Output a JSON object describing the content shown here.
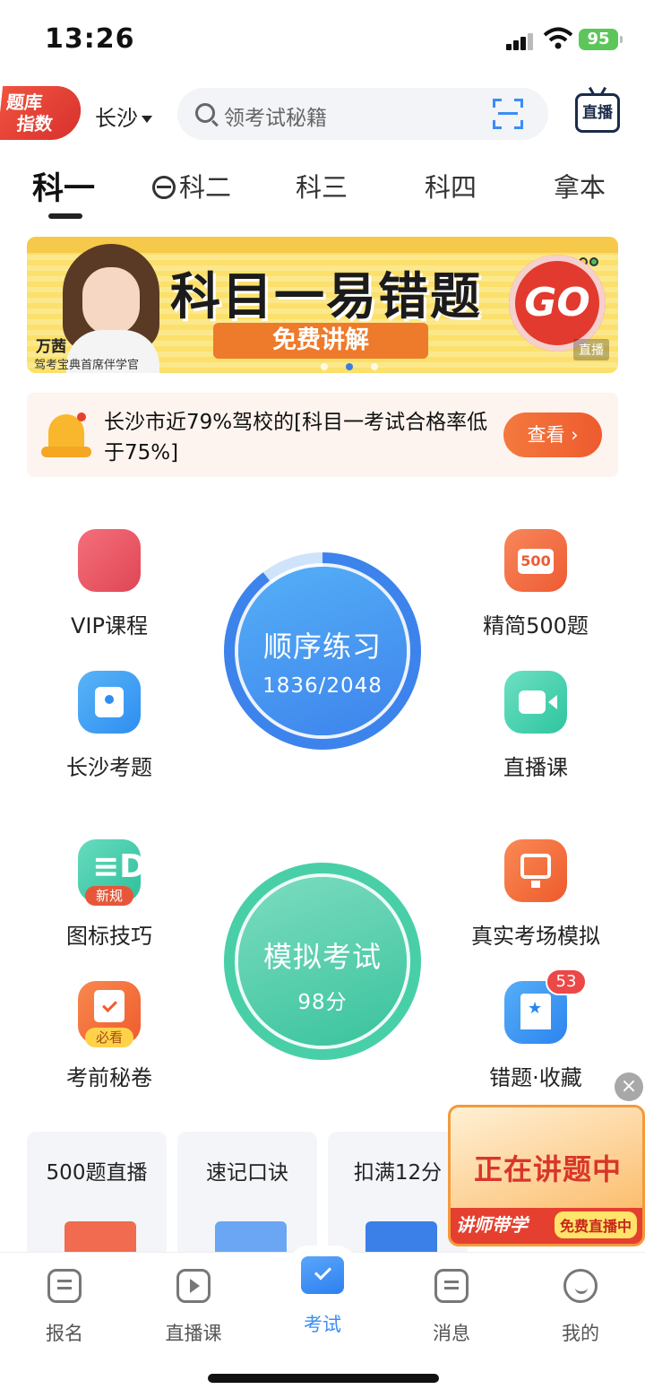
{
  "status": {
    "time": "13:26",
    "battery": "95"
  },
  "header": {
    "logo_line1": "题库",
    "logo_line2": "指数",
    "city": "长沙",
    "search_placeholder": "领考试秘籍",
    "live_label": "直播"
  },
  "tabs": [
    {
      "label": "科一",
      "active": true
    },
    {
      "label": "科二",
      "icon": "steering-wheel-icon"
    },
    {
      "label": "科三"
    },
    {
      "label": "科四"
    },
    {
      "label": "拿本"
    }
  ],
  "banner": {
    "title": "科目一易错题",
    "subtitle": "免费讲解",
    "host_name": "万茜",
    "host_title": "驾考宝典首席伴学官",
    "go": "GO",
    "live_tag": "直播"
  },
  "notice": {
    "text": "长沙市近79%驾校的[科目一考试合格率低于75%]",
    "button": "查看 ›"
  },
  "features": {
    "vip": "VIP课程",
    "simple500": "精简500题",
    "simple500_badge": "500",
    "local": "长沙考题",
    "live_course": "直播课",
    "icon_tips": "图标技巧",
    "icon_tips_badge": "新规",
    "real_exam": "真实考场模拟",
    "secret": "考前秘卷",
    "secret_badge": "必看",
    "wrong_fav": "错题·收藏",
    "wrong_fav_count": "53"
  },
  "practice": {
    "title": "顺序练习",
    "progress": "1836/2048",
    "done": 1836,
    "total": 2048
  },
  "mock": {
    "title": "模拟考试",
    "score": "98分"
  },
  "cards": [
    {
      "title": "500题直播"
    },
    {
      "title": "速记口诀"
    },
    {
      "title": "扣满12分"
    }
  ],
  "promo": {
    "main": "正在讲题中",
    "left": "讲师带学",
    "right": "免费直播中",
    "close": "×"
  },
  "tabbar": [
    {
      "label": "报名"
    },
    {
      "label": "直播课"
    },
    {
      "label": "考试",
      "active": true
    },
    {
      "label": "消息"
    },
    {
      "label": "我的"
    }
  ],
  "colors": {
    "accent": "#3b8df6",
    "orange": "#ee5b2e",
    "green": "#39c39d"
  }
}
